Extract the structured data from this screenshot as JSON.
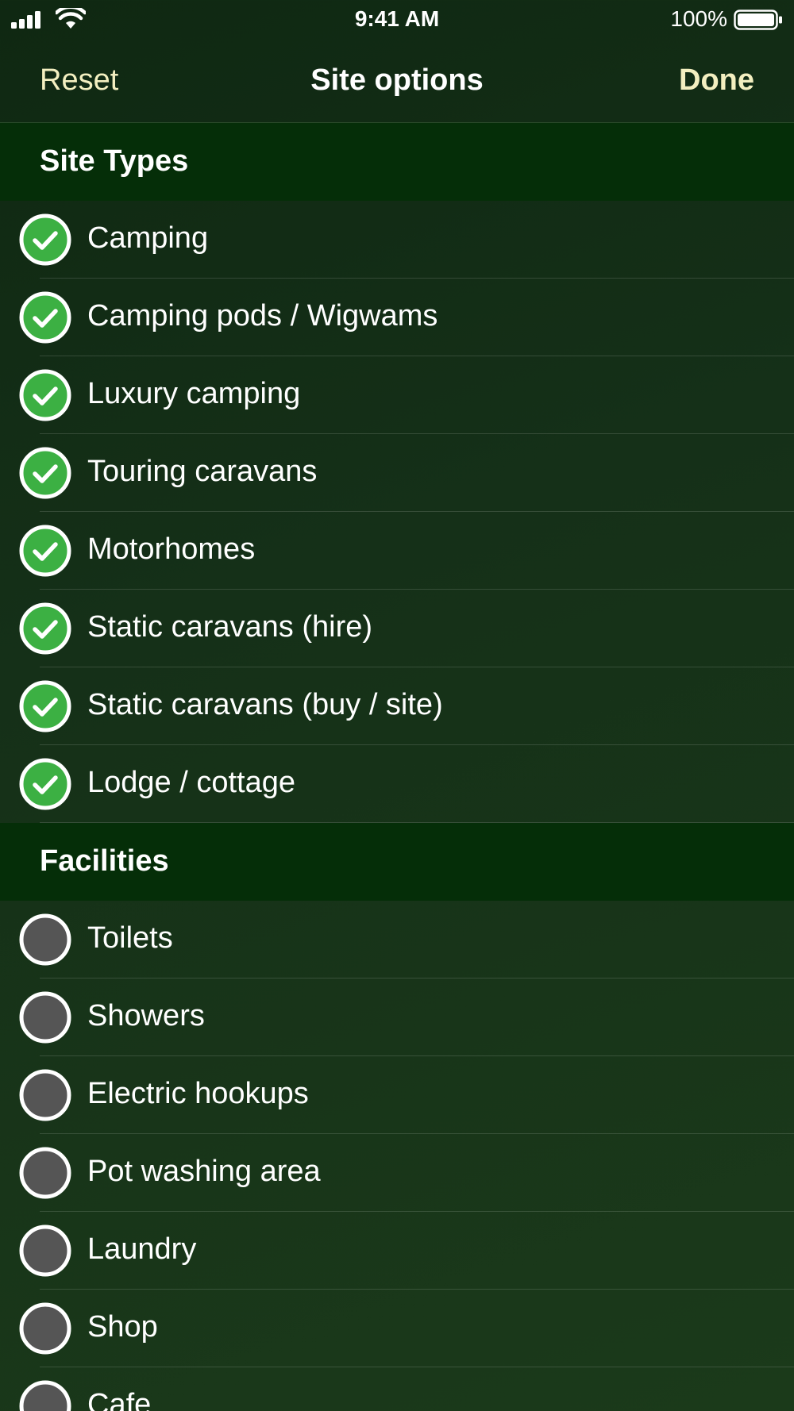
{
  "status_bar": {
    "time": "9:41 AM",
    "battery_percent": "100%",
    "battery_level": 1.0,
    "signal_icon": "cellular-signal-icon",
    "wifi_icon": "wifi-icon"
  },
  "nav": {
    "reset_label": "Reset",
    "title": "Site options",
    "done_label": "Done"
  },
  "colors": {
    "accent": "#f3efc0",
    "checked_fill": "#3cb043",
    "unchecked_fill": "#555555",
    "section_bg": "#052e08"
  },
  "sections": [
    {
      "title": "Site Types",
      "items": [
        {
          "label": "Camping",
          "checked": true
        },
        {
          "label": "Camping pods / Wigwams",
          "checked": true
        },
        {
          "label": "Luxury camping",
          "checked": true
        },
        {
          "label": "Touring caravans",
          "checked": true
        },
        {
          "label": "Motorhomes",
          "checked": true
        },
        {
          "label": "Static caravans (hire)",
          "checked": true
        },
        {
          "label": "Static caravans (buy / site)",
          "checked": true
        },
        {
          "label": "Lodge / cottage",
          "checked": true
        }
      ]
    },
    {
      "title": "Facilities",
      "items": [
        {
          "label": "Toilets",
          "checked": false
        },
        {
          "label": "Showers",
          "checked": false
        },
        {
          "label": "Electric hookups",
          "checked": false
        },
        {
          "label": "Pot washing area",
          "checked": false
        },
        {
          "label": "Laundry",
          "checked": false
        },
        {
          "label": "Shop",
          "checked": false
        },
        {
          "label": "Cafe",
          "checked": false
        }
      ]
    }
  ]
}
